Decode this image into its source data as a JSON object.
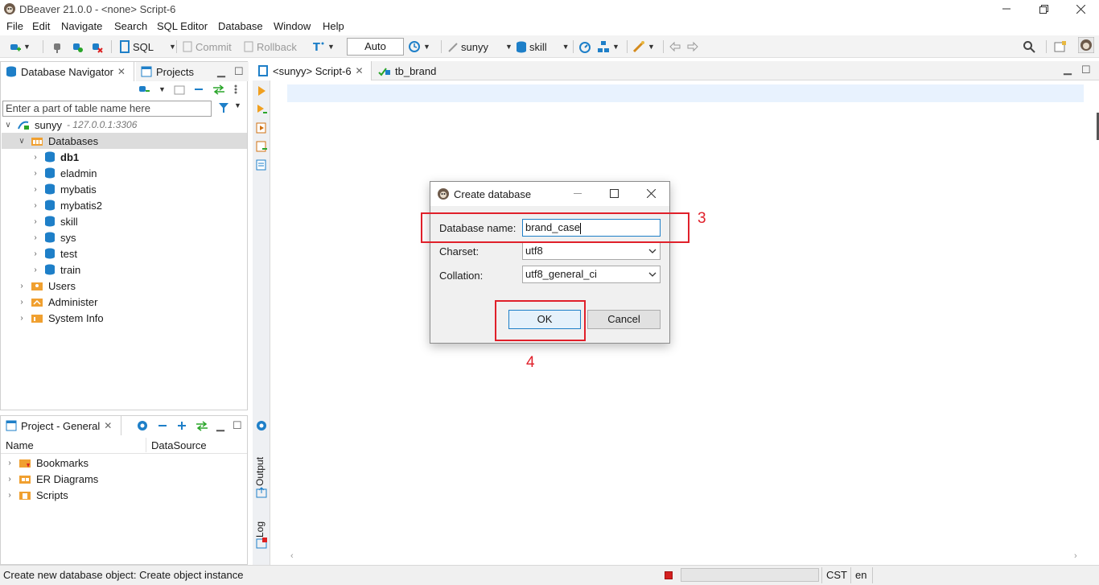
{
  "window": {
    "title": "DBeaver 21.0.0 - <none> Script-6"
  },
  "menu": [
    "File",
    "Edit",
    "Navigate",
    "Search",
    "SQL Editor",
    "Database",
    "Window",
    "Help"
  ],
  "toolbar": {
    "sql": "SQL",
    "commit": "Commit",
    "rollback": "Rollback",
    "transaction_mode": "Auto",
    "connection": "sunyy",
    "schema": "skill"
  },
  "navigator": {
    "tab_label": "Database Navigator",
    "projects_tab": "Projects",
    "filter_placeholder": "Enter a part of table name here",
    "connection": {
      "name": "sunyy",
      "host": "- 127.0.0.1:3306"
    },
    "databases_label": "Databases",
    "databases": [
      "db1",
      "eladmin",
      "mybatis",
      "mybatis2",
      "skill",
      "sys",
      "test",
      "train"
    ],
    "other_nodes": [
      "Users",
      "Administer",
      "System Info"
    ]
  },
  "project": {
    "tab_label": "Project - General",
    "columns": [
      "Name",
      "DataSource"
    ],
    "items": [
      "Bookmarks",
      "ER Diagrams",
      "Scripts"
    ]
  },
  "editor": {
    "tabs": [
      "<sunyy> Script-6",
      "tb_brand"
    ],
    "side_labels": {
      "output": "Output",
      "log": "Log"
    }
  },
  "dialog": {
    "title": "Create database",
    "name_label": "Database name:",
    "name_value": "brand_case",
    "charset_label": "Charset:",
    "charset_value": "utf8",
    "collation_label": "Collation:",
    "collation_value": "utf8_general_ci",
    "ok": "OK",
    "cancel": "Cancel"
  },
  "annotations": {
    "step3": "3",
    "step4": "4",
    "color": "#e0202a"
  },
  "status": {
    "message": "Create new database object: Create object instance",
    "timezone": "CST",
    "locale": "en"
  },
  "colors": {
    "accent": "#1e7fc8",
    "selection": "#dcdcdc",
    "current_line": "#e8f2fe"
  }
}
